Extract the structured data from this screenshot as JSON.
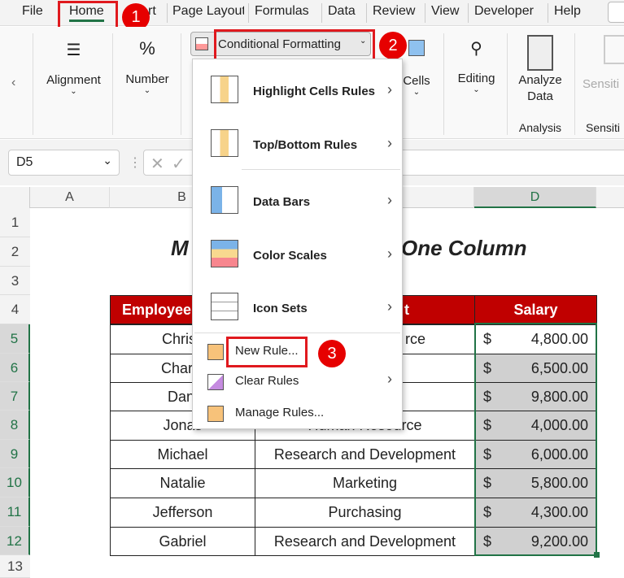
{
  "tabs": [
    "File",
    "Home",
    "rt",
    "Page Layout",
    "Formulas",
    "Data",
    "Review",
    "View",
    "Developer",
    "Help"
  ],
  "ribbon": {
    "alignment": "Alignment",
    "number": "Number",
    "conditional_formatting": "Conditional Formatting",
    "cells": "Cells",
    "editing": "Editing",
    "analyze_data": "Analyze Data",
    "analysis": "Analysis",
    "sensitivity": "Sensiti",
    "sensitivity_group": "Sensiti"
  },
  "name_box": "D5",
  "badges": [
    "1",
    "2",
    "3"
  ],
  "columns": [
    "A",
    "B",
    "D"
  ],
  "rows": [
    "1",
    "2",
    "3",
    "4",
    "5",
    "6",
    "7",
    "8",
    "9",
    "10",
    "11",
    "12",
    "13"
  ],
  "sheet": {
    "title_left": "M",
    "title_right": "One Column",
    "headers": {
      "employee": "Employee",
      "department": "t",
      "salary": "Salary"
    },
    "rows": [
      {
        "name": "Christi",
        "dept": "rce",
        "cur": "$",
        "salary": "4,800.00"
      },
      {
        "name": "Charlo",
        "dept": "",
        "cur": "$",
        "salary": "6,500.00"
      },
      {
        "name": "Dani",
        "dept": "",
        "cur": "$",
        "salary": "9,800.00"
      },
      {
        "name": "Jonas",
        "dept": "Human Resource",
        "cur": "$",
        "salary": "4,000.00"
      },
      {
        "name": "Michael",
        "dept": "Research and Development",
        "cur": "$",
        "salary": "6,000.00"
      },
      {
        "name": "Natalie",
        "dept": "Marketing",
        "cur": "$",
        "salary": "5,800.00"
      },
      {
        "name": "Jefferson",
        "dept": "Purchasing",
        "cur": "$",
        "salary": "4,300.00"
      },
      {
        "name": "Gabriel",
        "dept": "Research and Development",
        "cur": "$",
        "salary": "9,200.00"
      }
    ]
  },
  "menu": {
    "items": [
      "Highlight Cells Rules",
      "Top/Bottom Rules",
      "Data Bars",
      "Color Scales",
      "Icon Sets"
    ],
    "new_rule": "New Rule...",
    "clear_rules": "Clear Rules",
    "manage_rules": "Manage Rules..."
  },
  "colors": {
    "header_red": "#c00000",
    "accent_green": "#217346",
    "callout_red": "#e60000"
  }
}
